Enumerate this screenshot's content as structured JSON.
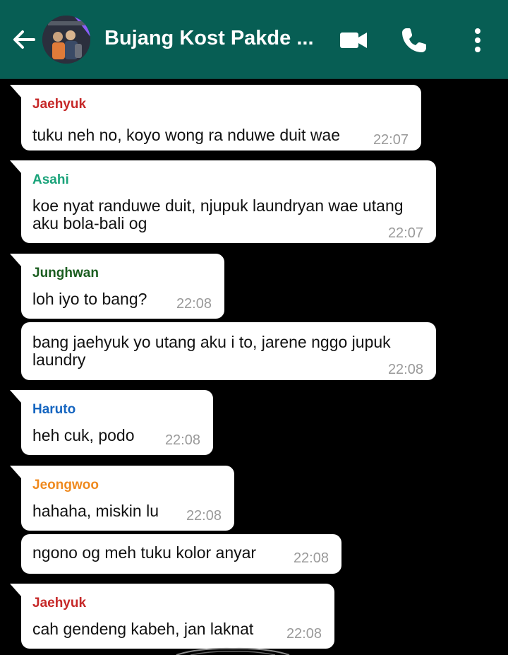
{
  "header": {
    "title": "Bujang Kost Pakde ...",
    "background_color": "#075e54"
  },
  "messages": [
    {
      "sender": "Jaehyuk",
      "sender_color": "#c62828",
      "text": "tuku neh no, koyo wong ra nduwe duit wae",
      "time": "22:07"
    },
    {
      "sender": "Asahi",
      "sender_color": "#1aa37a",
      "text": "koe nyat randuwe duit, njupuk laundryan wae utang\naku bola-bali og",
      "time": "22:07"
    },
    {
      "sender": "Junghwan",
      "sender_color": "#1b5e20",
      "text": "loh iyo to bang?",
      "time": "22:08"
    },
    {
      "sender": "",
      "sender_color": "",
      "text": "bang jaehyuk yo utang aku i to, jarene nggo jupuk\nlaundry",
      "time": "22:08"
    },
    {
      "sender": "Haruto",
      "sender_color": "#1565c0",
      "text": "heh cuk, podo",
      "time": "22:08"
    },
    {
      "sender": "Jeongwoo",
      "sender_color": "#ef8a1f",
      "text": "hahaha, miskin lu",
      "time": "22:08"
    },
    {
      "sender": "",
      "sender_color": "",
      "text": "ngono og meh tuku kolor anyar",
      "time": "22:08"
    },
    {
      "sender": "Jaehyuk",
      "sender_color": "#c62828",
      "text": "cah gendeng kabeh, jan laknat",
      "time": "22:08"
    }
  ]
}
